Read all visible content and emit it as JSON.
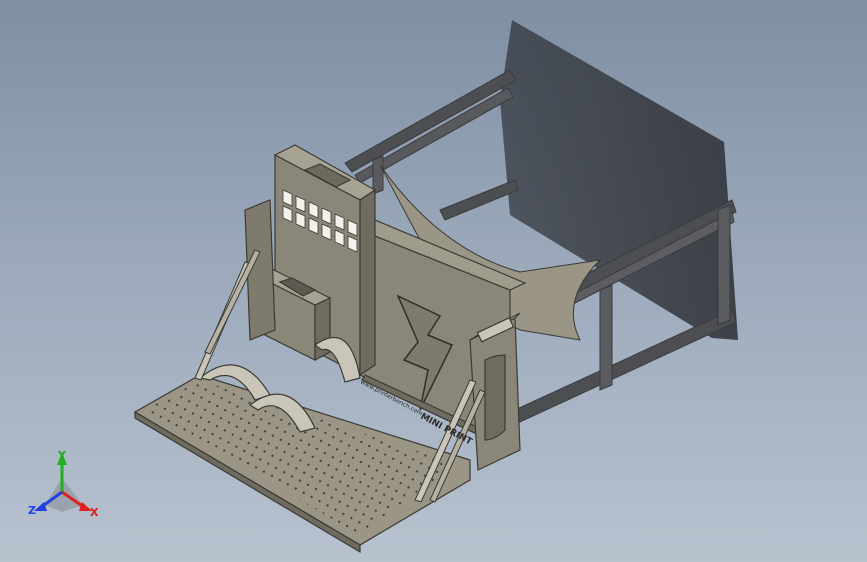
{
  "viewport": {
    "background_top": "#7f8fa3",
    "background_bottom": "#b8c2cf"
  },
  "model": {
    "body_color": "#8b8778",
    "edge_color": "#3b3a35",
    "rail_color": "#4d4e52",
    "shadow_color": "#2c2e33",
    "grille_lettering": "www.printerbench.com",
    "front_logo_text": "MINI PRINT"
  },
  "triad": {
    "x_label": "X",
    "y_label": "Y",
    "z_label": "Z",
    "x_color": "#e02020",
    "y_color": "#20b020",
    "z_color": "#2040e0"
  }
}
